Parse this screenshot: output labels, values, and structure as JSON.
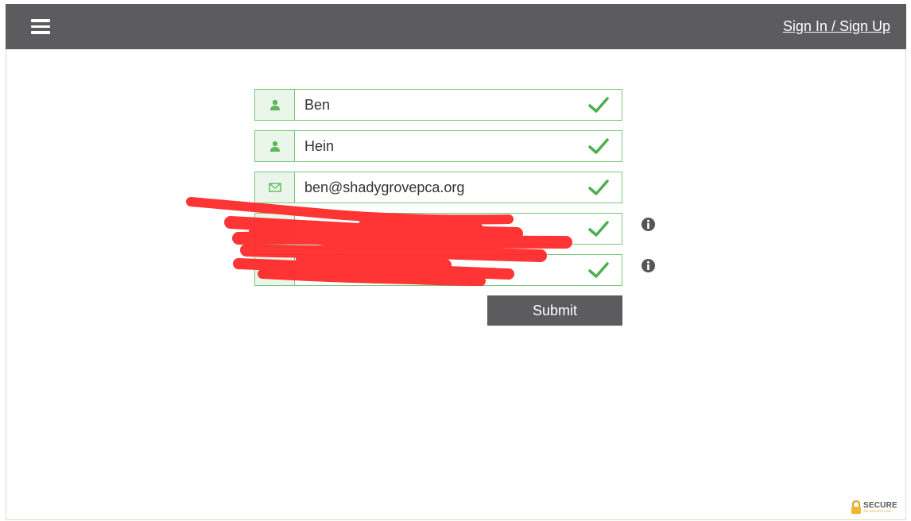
{
  "header": {
    "signin_label": "Sign In / Sign Up"
  },
  "form": {
    "first_name": "Ben",
    "last_name": "Hein",
    "email": "ben@shadygrovepca.org",
    "submit_label": "Submit"
  },
  "badge": {
    "label": "SECURE",
    "sub": "SSL ENCRYPTION"
  },
  "colors": {
    "topbar": "#5c5c5e",
    "valid_border": "#7bc67e",
    "check": "#4caf50",
    "redaction": "#ff2a2a"
  },
  "icons": [
    "menu-icon",
    "user-icon",
    "envelope-icon",
    "checkmark-icon",
    "info-icon",
    "lock-icon"
  ]
}
